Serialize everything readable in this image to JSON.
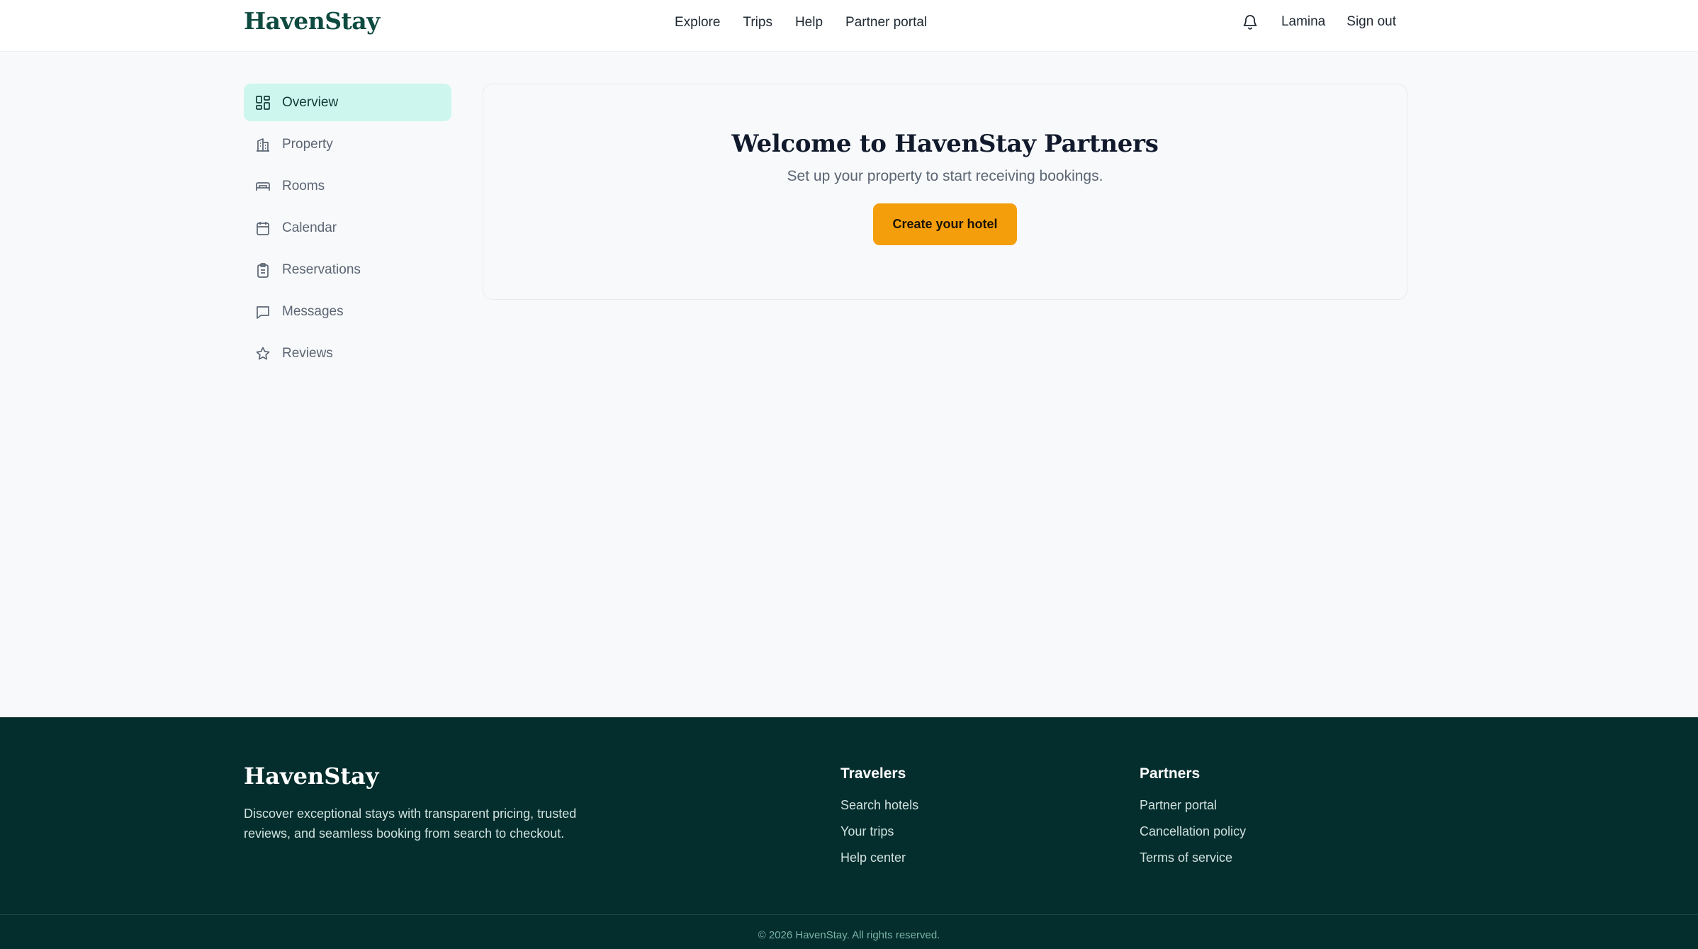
{
  "header": {
    "brand": "HavenStay",
    "nav": [
      "Explore",
      "Trips",
      "Help",
      "Partner portal"
    ],
    "user": "Lamina",
    "signout": "Sign out"
  },
  "sidebar": {
    "items": [
      {
        "label": "Overview",
        "icon": "dashboard-icon",
        "active": true
      },
      {
        "label": "Property",
        "icon": "building-icon",
        "active": false
      },
      {
        "label": "Rooms",
        "icon": "bed-icon",
        "active": false
      },
      {
        "label": "Calendar",
        "icon": "calendar-icon",
        "active": false
      },
      {
        "label": "Reservations",
        "icon": "clipboard-icon",
        "active": false
      },
      {
        "label": "Messages",
        "icon": "message-icon",
        "active": false
      },
      {
        "label": "Reviews",
        "icon": "star-icon",
        "active": false
      }
    ]
  },
  "main": {
    "title": "Welcome to HavenStay Partners",
    "subtitle": "Set up your property to start receiving bookings.",
    "cta": "Create your hotel"
  },
  "footer": {
    "brand": "HavenStay",
    "description": "Discover exceptional stays with transparent pricing, trusted reviews, and seamless booking from search to checkout.",
    "travelers": {
      "heading": "Travelers",
      "links": [
        "Search hotels",
        "Your trips",
        "Help center"
      ]
    },
    "partners": {
      "heading": "Partners",
      "links": [
        "Partner portal",
        "Cancellation policy",
        "Terms of service"
      ]
    },
    "copyright": "© 2026 HavenStay. All rights reserved."
  },
  "colors": {
    "brand": "#0f4a40",
    "accent": "#f59e0b",
    "active_bg": "#cdf7ee",
    "footer_bg": "#042d2d"
  }
}
